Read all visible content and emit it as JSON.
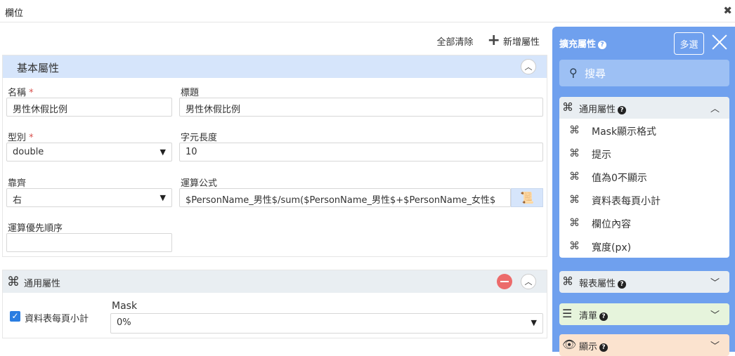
{
  "window": {
    "title": "欄位",
    "close": "✖"
  },
  "toolbar": {
    "clear_all": "全部清除",
    "add_property": "新增屬性"
  },
  "basic": {
    "title": "基本屬性",
    "name_label": "名稱",
    "name_value": "男性休假比例",
    "caption_label": "標題",
    "caption_value": "男性休假比例",
    "type_label": "型別",
    "type_value": "double",
    "length_label": "字元長度",
    "length_value": "10",
    "align_label": "靠齊",
    "align_value": "右",
    "formula_label": "運算公式",
    "formula_value": "$PersonName_男性$/sum($PersonName_男性$+$PersonName_女性$",
    "priority_label": "運算優先順序",
    "priority_value": "",
    "required_mark": "*"
  },
  "general": {
    "title": "通用屬性",
    "subtotal_label": "資料表每頁小計",
    "subtotal_checked": true,
    "mask_label": "Mask",
    "mask_value": "0%"
  },
  "side": {
    "title": "擴充屬性",
    "multi_label": "多選",
    "search_placeholder": "搜尋",
    "groups": [
      {
        "title": "通用屬性",
        "color": "#e9eef2",
        "expanded": true,
        "items": [
          "Mask顯示格式",
          "提示",
          "值為0不顯示",
          "資料表每頁小計",
          "欄位內容",
          "寬度(px)"
        ]
      },
      {
        "title": "報表屬性",
        "color": "#e9eef2",
        "expanded": false
      },
      {
        "title": "清單",
        "color": "#e6f4dc",
        "expanded": false
      },
      {
        "title": "顯示",
        "color": "#fbe3cf",
        "expanded": false
      }
    ]
  },
  "colors": {
    "accent": "#6fa0ee",
    "header_bg": "#d6e5fb",
    "remove": "#ec6b6b",
    "checkbox": "#2a7de1"
  },
  "icons": {
    "command": "command-icon",
    "help": "question-icon",
    "search": "search-icon",
    "list": "list-icon",
    "eye": "eye-icon",
    "script": "script-icon"
  }
}
